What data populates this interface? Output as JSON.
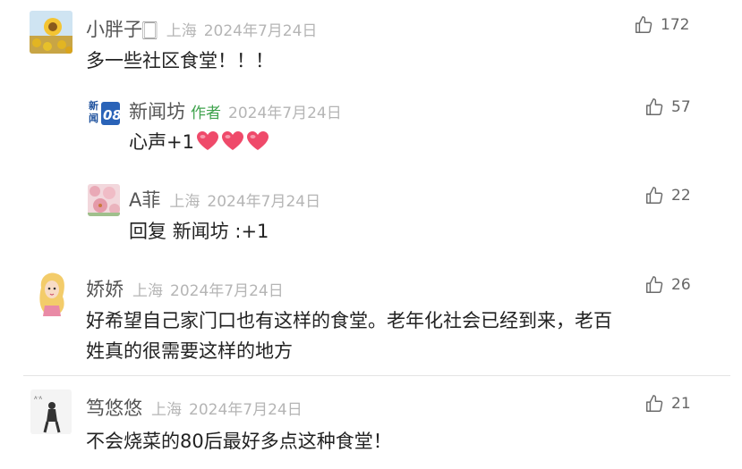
{
  "colors": {
    "author_tag": "#3fa34d",
    "meta_gray": "#b5b5b5",
    "name_gray": "#555555",
    "text": "#222222",
    "heart": "#ef4a6a"
  },
  "comments": [
    {
      "name": "小胖子🀆",
      "location": "上海",
      "date": "2024年7月24日",
      "likes": "172",
      "text": "多一些社区食堂！！！",
      "avatar_icon": "sunflower-field-avatar-icon"
    },
    {
      "name": "新闻坊",
      "author_tag": "作者",
      "date": "2024年7月24日",
      "likes": "57",
      "text": "心声+1",
      "emoji_count": 3,
      "avatar_icon": "xinwenfang-logo-avatar-icon"
    },
    {
      "name": "A菲",
      "location": "上海",
      "date": "2024年7月24日",
      "likes": "22",
      "reply_prefix": "回复",
      "reply_to": "新闻坊",
      "text": ":+1",
      "avatar_icon": "pink-blossom-avatar-icon"
    },
    {
      "name": "娇娇",
      "location": "上海",
      "date": "2024年7月24日",
      "likes": "26",
      "text_line1": "好希望自己家门口也有这样的食堂。老年化社会已经到来，老百",
      "text_line2": "姓真的很需要这样的地方",
      "avatar_icon": "cartoon-princess-avatar-icon"
    },
    {
      "name": "笃悠悠",
      "location": "上海",
      "date": "2024年7月24日",
      "likes": "21",
      "text": "不会烧菜的80后最好多点这种食堂！",
      "avatar_icon": "sketch-figure-avatar-icon"
    }
  ]
}
